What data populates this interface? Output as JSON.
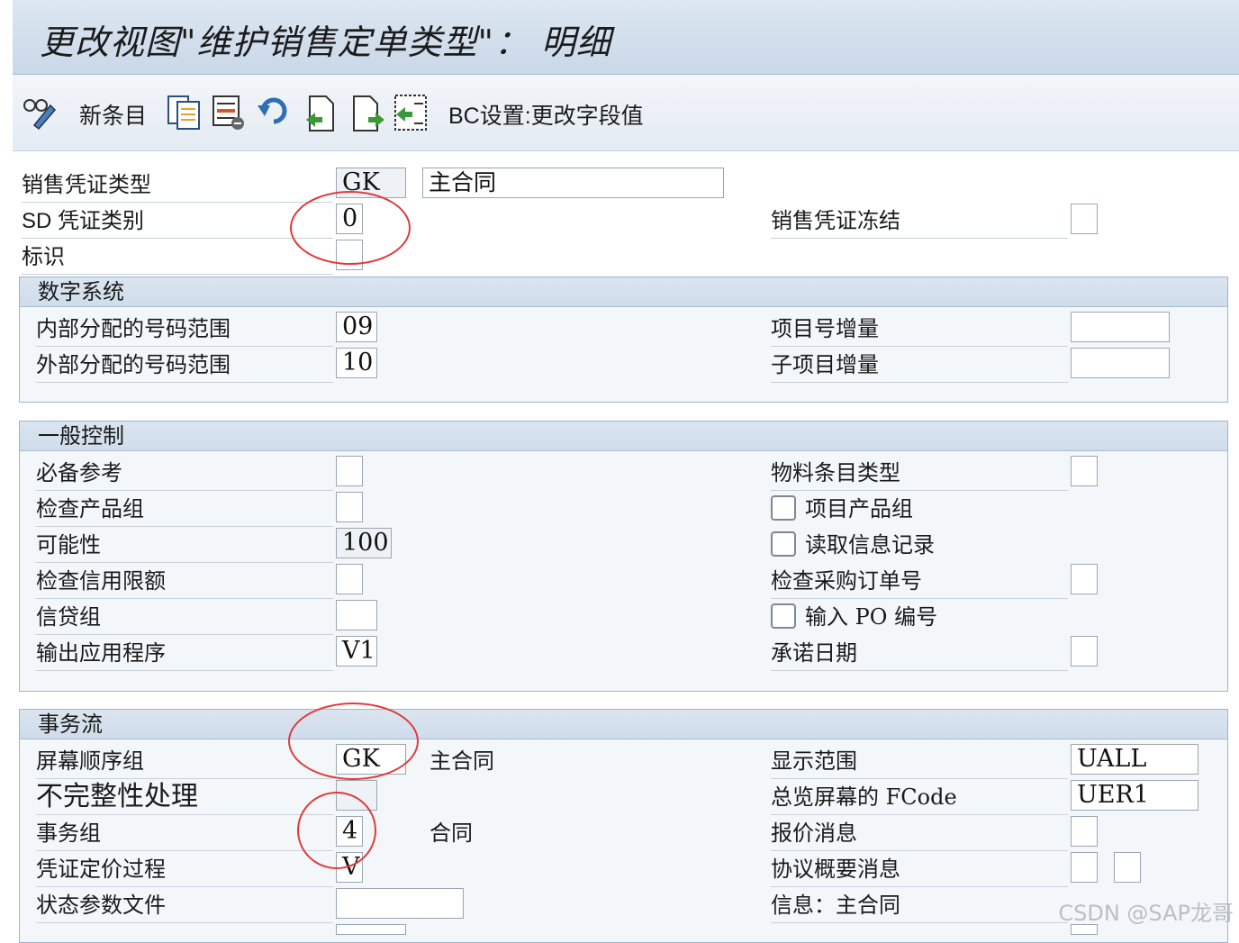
{
  "window": {
    "title": "更改视图\"维护销售定单类型\"： 明细"
  },
  "toolbar": {
    "new_entries_label": "新条目",
    "bc_set_label": "BC设置:更改字段值",
    "icons": [
      "display-change-icon",
      "copy-icon",
      "delete-icon",
      "undo-icon",
      "previous-entry-icon",
      "next-entry-icon",
      "select-icon"
    ]
  },
  "header": {
    "doc_type_label": "销售凭证类型",
    "doc_type_value": "GK",
    "doc_type_desc": "主合同",
    "sd_category_label": "SD 凭证类别",
    "sd_category_value": "0",
    "doc_block_label": "销售凭证冻结",
    "indicator_label": "标识"
  },
  "numbering": {
    "title": "数字系统",
    "internal_label": "内部分配的号码范围",
    "internal_value": "09",
    "external_label": "外部分配的号码范围",
    "external_value": "10",
    "item_incr_label": "项目号增量",
    "sub_item_incr_label": "子项目增量"
  },
  "general": {
    "title": "一般控制",
    "ref_mandatory_label": "必备参考",
    "check_division_label": "检查产品组",
    "probability_label": "可能性",
    "probability_value": "100",
    "check_credit_label": "检查信用限额",
    "credit_group_label": "信贷组",
    "output_app_label": "输出应用程序",
    "output_app_value": "V1",
    "material_entry_label": "物料条目类型",
    "item_division_label": "项目产品组",
    "read_info_label": "读取信息记录",
    "check_po_label": "检查采购订单号",
    "enter_po_label": "输入 PO 编号",
    "commitment_label": "承诺日期"
  },
  "transaction": {
    "title": "事务流",
    "screen_seq_label": "屏幕顺序组",
    "screen_seq_value": "GK",
    "screen_seq_desc": "主合同",
    "incompletion_label": "不完整性处理",
    "trans_group_label": "事务组",
    "trans_group_value": "4",
    "trans_group_desc": "合同",
    "doc_pricing_label": "凭证定价过程",
    "doc_pricing_value": "V",
    "status_profile_label": "状态参数文件",
    "display_range_label": "显示范围",
    "display_range_value": "UALL",
    "fcode_label": "总览屏幕的 FCode",
    "fcode_value": "UER1",
    "quotation_msg_label": "报价消息",
    "agreement_msg_label": "协议概要消息",
    "info_label": "信息：主合同"
  },
  "watermark": "CSDN @SAP龙哥",
  "colors": {
    "title_bg": "#c9d7e8",
    "group_border": "#9eb4cc",
    "annotation": "#e03a3a"
  }
}
